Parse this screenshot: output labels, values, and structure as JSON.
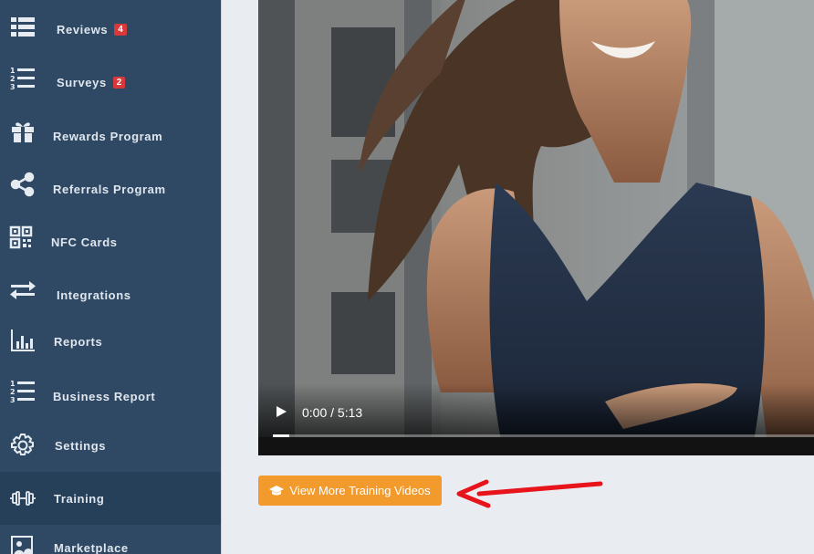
{
  "sidebar": {
    "items": [
      {
        "label": "Reviews",
        "icon": "list-icon",
        "badge": "4"
      },
      {
        "label": "Surveys",
        "icon": "numbered-list-icon",
        "badge": "2"
      },
      {
        "label": "Rewards Program",
        "icon": "gift-icon"
      },
      {
        "label": "Referrals Program",
        "icon": "share-icon"
      },
      {
        "label": "NFC Cards",
        "icon": "qr-code-icon"
      },
      {
        "label": "Integrations",
        "icon": "exchange-arrows-icon"
      },
      {
        "label": "Reports",
        "icon": "bar-chart-icon"
      },
      {
        "label": "Business Report",
        "icon": "numbered-list-icon"
      },
      {
        "label": "Settings",
        "icon": "gear-icon"
      },
      {
        "label": "Training",
        "icon": "dumbbell-icon",
        "active": true
      },
      {
        "label": "Marketplace",
        "icon": "store-icon"
      }
    ]
  },
  "video": {
    "time_display": "0:00 / 5:13",
    "progress_fraction": 0.03
  },
  "cta": {
    "label": "View More Training Videos",
    "icon": "graduation-cap-icon"
  },
  "colors": {
    "sidebar_bg": "#2f4863",
    "badge": "#d9383a",
    "cta_bg": "#f39a2d",
    "annotation_arrow": "#e8141c"
  }
}
